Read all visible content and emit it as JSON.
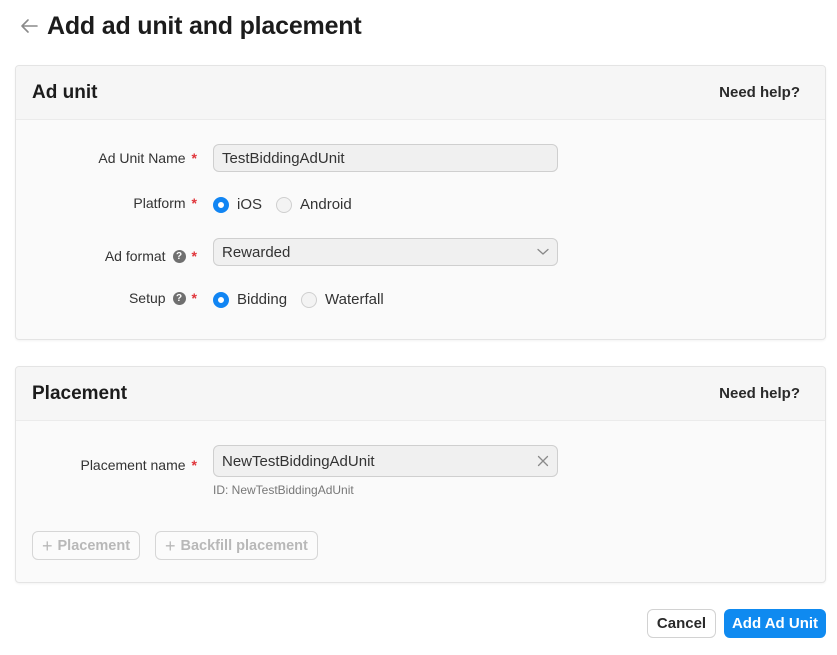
{
  "header": {
    "back_icon": "arrow-left-icon",
    "title": "Add ad unit and placement"
  },
  "ad_unit_section": {
    "title": "Ad unit",
    "help_link": "Need help?",
    "fields": {
      "name": {
        "label": "Ad Unit Name",
        "required_mark": "*",
        "value": "TestBiddingAdUnit"
      },
      "platform": {
        "label": "Platform",
        "required_mark": "*",
        "options": [
          {
            "label": "iOS",
            "selected": true
          },
          {
            "label": "Android",
            "selected": false
          }
        ]
      },
      "ad_format": {
        "label": "Ad format",
        "help_icon": "question-circle-icon",
        "help_glyph": "?",
        "required_mark": "*",
        "value": "Rewarded",
        "dropdown_icon": "chevron-down-icon"
      },
      "setup": {
        "label": "Setup",
        "help_icon": "question-circle-icon",
        "help_glyph": "?",
        "required_mark": "*",
        "options": [
          {
            "label": "Bidding",
            "selected": true
          },
          {
            "label": "Waterfall",
            "selected": false
          }
        ]
      }
    }
  },
  "placement_section": {
    "title": "Placement",
    "help_link": "Need help?",
    "placement_name": {
      "label": "Placement name",
      "required_mark": "*",
      "value": "NewTestBiddingAdUnit",
      "clear_icon": "close-icon",
      "id_text": "ID: NewTestBiddingAdUnit"
    },
    "buttons": {
      "add_placement": {
        "icon": "plus-icon",
        "glyph": "+",
        "label": "Placement",
        "disabled": true
      },
      "add_backfill": {
        "icon": "plus-icon",
        "glyph": "+",
        "label": "Backfill placement",
        "disabled": true
      }
    }
  },
  "footer": {
    "cancel_label": "Cancel",
    "submit_label": "Add Ad Unit"
  },
  "colors": {
    "accent": "#0f8af0",
    "required": "#e0353b",
    "radio_checked": "#1185f3"
  }
}
